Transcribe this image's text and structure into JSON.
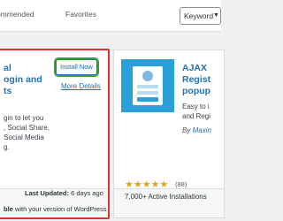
{
  "filter_bar": {
    "tabs": [
      "ommended",
      "Favorites"
    ],
    "search_type": "Keyword"
  },
  "cards": [
    {
      "title": "al\nogin and\nts",
      "install_label": "Install Now",
      "more_details": "More Details",
      "description": "gin to let you\n, Social Share,\nSocial Media\ng.",
      "last_updated_label": "Last Updated:",
      "last_updated_value": "6 days ago",
      "compat_strong": "ble",
      "compat_rest": "with your version of WordPress"
    },
    {
      "title": "AJAX\nRegist\npopup",
      "description": "Easy to i\nand Regi",
      "author_prefix": "By",
      "author_name": "Maxin",
      "rating_count": "(88)",
      "stars": 5,
      "installs": "7,000+ Active Installations"
    }
  ],
  "colors": {
    "accent": "#2271b1",
    "highlight_red": "#d63638",
    "highlight_green": "#3a9c3a",
    "star": "#dba617",
    "thumb_bg": "#2aa0d8"
  }
}
